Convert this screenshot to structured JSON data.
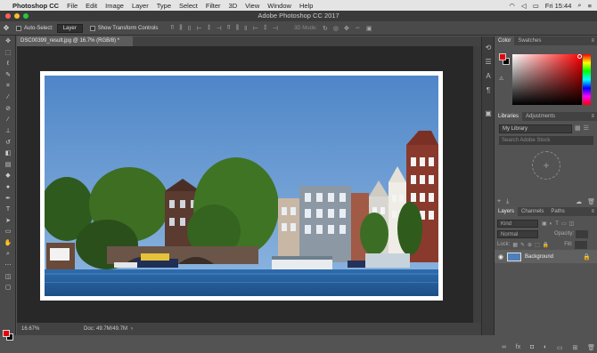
{
  "menubar": {
    "app": "Photoshop CC",
    "items": [
      "File",
      "Edit",
      "Image",
      "Layer",
      "Type",
      "Select",
      "Filter",
      "3D",
      "View",
      "Window",
      "Help"
    ],
    "clock": "Fri 15:44"
  },
  "window": {
    "title": "Adobe Photoshop CC 2017"
  },
  "options": {
    "auto_select_label": "Auto-Select:",
    "auto_select_value": "Layer",
    "transform_label": "Show Transform Controls",
    "mode_3d": "3D Mode:"
  },
  "document": {
    "tab_title": "DSC00399_result.jpg @ 16.7% (RGB/8) *",
    "zoom": "16.67%",
    "doc_size": "Doc: 49.7M/49.7M"
  },
  "color_panel": {
    "tabs": [
      "Color",
      "Swatches"
    ],
    "foreground": "#e8000b",
    "background": "#000000"
  },
  "libraries_panel": {
    "tabs": [
      "Libraries",
      "Adjustments"
    ],
    "library": "My Library",
    "search_placeholder": "Search Adobe Stock"
  },
  "layers_panel": {
    "tabs": [
      "Layers",
      "Channels",
      "Paths"
    ],
    "kind": "Kind",
    "blend_mode": "Normal",
    "opacity_label": "Opacity:",
    "lock_label": "Lock:",
    "fill_label": "Fill:",
    "layer_name": "Background"
  },
  "colors": {
    "menubar_bg": "#e4e4e4",
    "chrome_dark": "#3a3a3a",
    "panel_bg": "#535353",
    "canvas_bg": "#282828",
    "sky": "#5d8fcc"
  }
}
